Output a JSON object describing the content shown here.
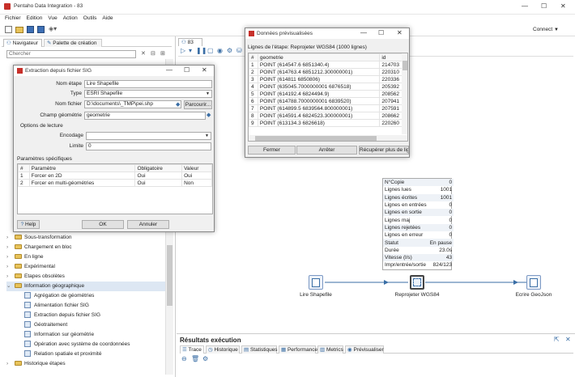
{
  "app": {
    "title": "Pentaho Data Integration - 83",
    "connect_label": "Connect"
  },
  "menu": [
    "Fichier",
    "Edition",
    "Vue",
    "Action",
    "Outils",
    "Aide"
  ],
  "left_panel": {
    "tabs": [
      "Navigateur",
      "Palette de création"
    ],
    "search_placeholder": "Chercher",
    "tree": [
      {
        "label": "Sous-transformation",
        "type": "folder"
      },
      {
        "label": "Chargement en bloc",
        "type": "folder"
      },
      {
        "label": "En ligne",
        "type": "folder"
      },
      {
        "label": "Expérimental",
        "type": "folder"
      },
      {
        "label": "Etapes obsolètes",
        "type": "folder"
      },
      {
        "label": "Information géographique",
        "type": "folder-open"
      },
      {
        "label": "Agrégation de géométries",
        "type": "step"
      },
      {
        "label": "Alimentation fichier SIG",
        "type": "step"
      },
      {
        "label": "Extraction depuis fichier SIG",
        "type": "step"
      },
      {
        "label": "Géotraitement",
        "type": "step"
      },
      {
        "label": "Information sur géométrie",
        "type": "step"
      },
      {
        "label": "Opération avec système de coordonnées",
        "type": "step"
      },
      {
        "label": "Relation spatiale et proximité",
        "type": "step"
      },
      {
        "label": "Historique étapes",
        "type": "folder"
      }
    ]
  },
  "canvas_tab": "83",
  "sig_dialog": {
    "title": "Extraction depuis fichier SIG",
    "labels": {
      "step_name": "Nom étape",
      "type": "Type",
      "file_name": "Nom fichier",
      "geom_field": "Champ géométrie",
      "read_options": "Options de lecture",
      "encoding": "Encodage",
      "limit": "Limite",
      "specific_params": "Paramètres spécifiques"
    },
    "values": {
      "step_name": "Lire Shapefile",
      "type": "ESRI Shapefile",
      "file_name": "D:\\documents\\_TMP\\pei.shp",
      "geom_field": "geometrie",
      "encoding": "",
      "limit": "0"
    },
    "browse_button": "Parcourir...",
    "table_headers": [
      "#",
      "Paramètre",
      "Obligatoire",
      "Valeur"
    ],
    "table_rows": [
      [
        "1",
        "Forcer en 2D",
        "Oui",
        "Oui"
      ],
      [
        "2",
        "Forcer en multi-géométries",
        "Oui",
        "Non"
      ]
    ],
    "help_button": "Help",
    "ok_button": "OK",
    "cancel_button": "Annuler"
  },
  "preview_dialog": {
    "title": "Données prévisualisées",
    "subtitle": "Lignes de l'étape: Reprojeter WGS84 (1000 lignes)",
    "headers": [
      "#",
      "geometrie",
      "id"
    ],
    "rows": [
      [
        "1",
        "POINT (614547.6 6851340.4)",
        "214703"
      ],
      [
        "2",
        "POINT (614763.4 6851212.300000001)",
        "220310"
      ],
      [
        "3",
        "POINT (614811 6850806)",
        "220336"
      ],
      [
        "4",
        "POINT (635045.7000000001 6876518)",
        "205392"
      ],
      [
        "5",
        "POINT (614192.4 6824494.9)",
        "208562"
      ],
      [
        "6",
        "POINT (614788.7000000001 6839520)",
        "207941"
      ],
      [
        "7",
        "POINT (614899.5 6839564.800000001)",
        "207591"
      ],
      [
        "8",
        "POINT (614591.4 6824523.300000001)",
        "208662"
      ],
      [
        "9",
        "POINT (613134.3 6826618)",
        "220260"
      ]
    ],
    "close_button": "Fermer",
    "stop_button": "Arrêter",
    "more_button": "Récupérer plus de lig"
  },
  "stats": [
    [
      "N°Copie",
      "0"
    ],
    [
      "Lignes lues",
      "1001"
    ],
    [
      "Lignes écrites",
      "1001"
    ],
    [
      "Lignes en entrées",
      "0"
    ],
    [
      "Lignes en sortie",
      "0"
    ],
    [
      "Lignes maj",
      "0"
    ],
    [
      "Lignes rejetées",
      "0"
    ],
    [
      "Lignes en erreur",
      "0"
    ],
    [
      "Statut",
      "En pause"
    ],
    [
      "Durée",
      "23.0s"
    ],
    [
      "Vitesse (l/s)",
      "43"
    ],
    [
      "Impr/entrée/sortie",
      "824/123"
    ]
  ],
  "canvas_steps": [
    "Lire Shapefile",
    "Reprojeter WGS84",
    "Ecrire GeoJson"
  ],
  "results": {
    "title": "Résultats exécution",
    "tabs": [
      "Trace",
      "Historique",
      "Statistiques",
      "Performance",
      "Metrics",
      "Prévisualiser"
    ]
  }
}
